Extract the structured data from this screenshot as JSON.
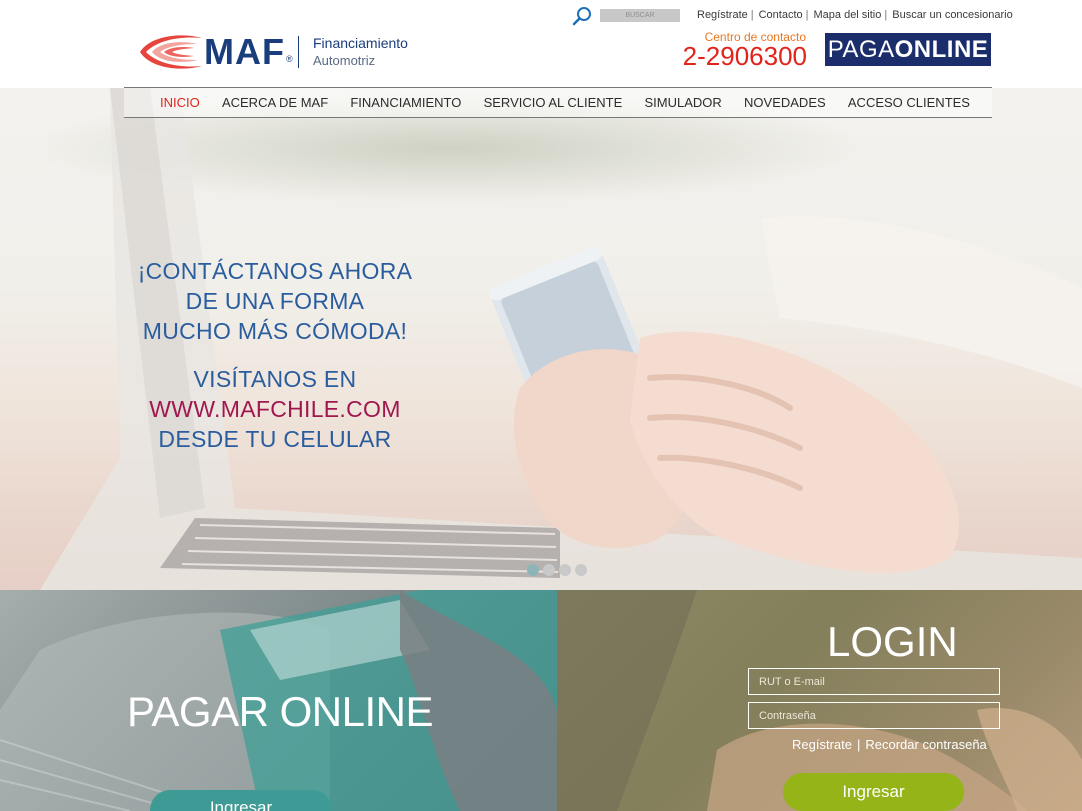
{
  "header": {
    "search": {
      "placeholder": "BUSCAR"
    },
    "top_links": [
      "Regístrate",
      "Contacto",
      "Mapa del sitio",
      "Buscar un concesionario"
    ],
    "logo": {
      "word": "MAF",
      "reg": "®",
      "line1": "Financiamiento",
      "line2": "Automotriz"
    },
    "contact": {
      "label": "Centro de contacto",
      "phone": "2-2906300"
    },
    "paga_online": {
      "part1": "PAGA",
      "part2": "ONLINE"
    }
  },
  "nav": {
    "items": [
      "INICIO",
      "ACERCA DE MAF",
      "FINANCIAMIENTO",
      "SERVICIO AL CLIENTE",
      "SIMULADOR",
      "NOVEDADES",
      "ACCESO CLIENTES"
    ],
    "active": "INICIO"
  },
  "hero": {
    "line1": "¡CONTÁCTANOS AHORA",
    "line2": "DE UNA FORMA",
    "line3": "MUCHO MÁS CÓMODA!",
    "line4": "VISÍTANOS EN",
    "line5": "WWW.MAFCHILE.COM",
    "line6": "DESDE TU CELULAR",
    "slides": 4,
    "active_slide": 1
  },
  "pay": {
    "title": "PAGAR ONLINE",
    "button": "Ingresar"
  },
  "login": {
    "title": "LOGIN",
    "user_placeholder": "RUT o E-mail",
    "password_placeholder": "Contraseña",
    "register": "Regístrate",
    "separator": "|",
    "recover": "Recordar contraseña",
    "button": "Ingresar"
  },
  "colors": {
    "brand_blue": "#1a3d7c",
    "phone_red": "#e2231a",
    "contact_orange": "#e87722",
    "paga_bg": "#1b2e6b",
    "login_green": "#94b417",
    "pay_teal": "#3e9a94"
  },
  "icons": {
    "search": "search-icon",
    "logo_swoosh": "maf-swoosh-icon"
  }
}
